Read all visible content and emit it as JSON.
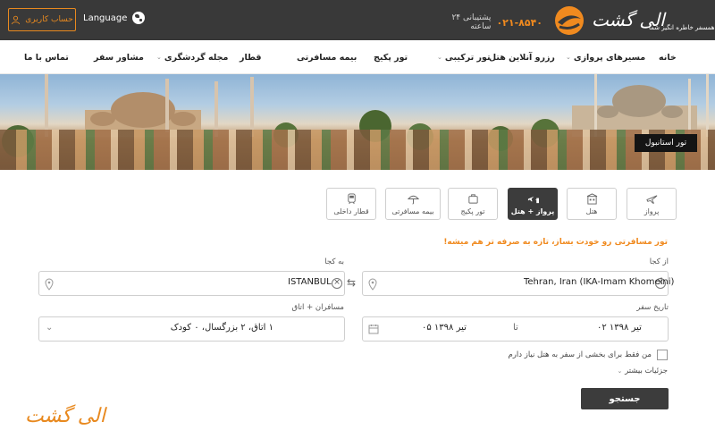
{
  "topbar": {
    "account_label": "حساب کاربری",
    "language_label": "Language",
    "support_phone": "۰۲۱-۸۵۴۰",
    "support_label": "پشتیبانی ۲۴ ساعته",
    "logo_text": "الی گشت",
    "logo_tagline": "همسفر خاطره انگیز شما"
  },
  "nav": {
    "items": [
      {
        "label": "خانه",
        "has_dropdown": false
      },
      {
        "label": "مسیرهای پروازی",
        "has_dropdown": true
      },
      {
        "label": "رزرو آنلاین هتل",
        "has_dropdown": true
      },
      {
        "label": "تور ترکیبی",
        "has_dropdown": true
      },
      {
        "label": "تور پکیج",
        "has_dropdown": false
      },
      {
        "label": "بیمه مسافرتی",
        "has_dropdown": false
      },
      {
        "label": "قطار",
        "has_dropdown": false
      },
      {
        "label": "مجله گردشگری",
        "has_dropdown": true
      },
      {
        "label": "مشاور سفر",
        "has_dropdown": false
      },
      {
        "label": "تماس با ما",
        "has_dropdown": false
      }
    ]
  },
  "hero": {
    "badge": "تور استانبول"
  },
  "search": {
    "tabs": [
      {
        "label": "پرواز",
        "icon": "airplane-icon",
        "active": false
      },
      {
        "label": "هتل",
        "icon": "hotel-icon",
        "active": false
      },
      {
        "label": "پرواز + هتل",
        "icon": "flight-hotel-icon",
        "active": true
      },
      {
        "label": "تور پکیج",
        "icon": "suitcase-icon",
        "active": false
      },
      {
        "label": "بیمه مسافرتی",
        "icon": "umbrella-icon",
        "active": false
      },
      {
        "label": "قطار داخلی",
        "icon": "train-icon",
        "active": false
      }
    ],
    "promo": "تور مسافرتی رو خودت بساز، تازه به صرفه تر هم میشه!",
    "from_label": "از کجا",
    "from_value": "Tehran, Iran (IKA-Imam Khomeini)",
    "to_label": "به کجا",
    "to_value": "ISTANBUL",
    "date_label": "تاریخ سفر",
    "date_from": "۰۲ تیر ۱۳۹۸",
    "date_sep": "تا",
    "date_to": "۰۵ تیر ۱۳۹۸",
    "pax_label": "مسافران + اتاق",
    "pax_value": "۱ اتاق، ۲ بزرگسال، ۰ کودک",
    "partial_hotel_label": "من فقط برای بخشی از سفر به هتل نیاز دارم",
    "partial_hotel_checked": false,
    "details_label": "جزئیات بیشتر",
    "submit_label": "جستجو"
  },
  "footer": {
    "logo_text": "الی گشت"
  },
  "colors": {
    "accent": "#f08a1f",
    "dark": "#393939",
    "button": "#3c3c3c"
  }
}
